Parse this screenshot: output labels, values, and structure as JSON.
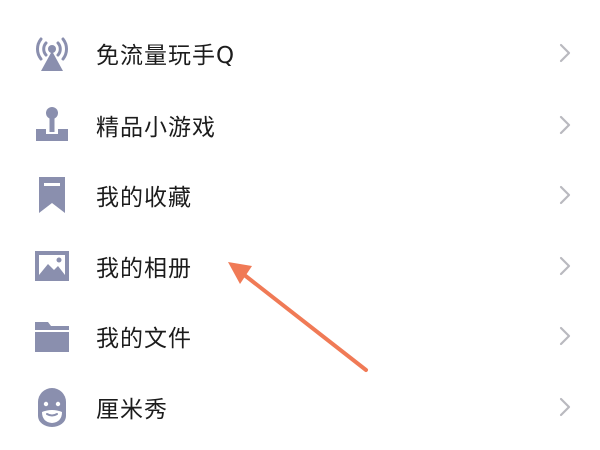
{
  "menu": {
    "items": [
      {
        "label": "免流量玩手Q",
        "icon": "antenna-icon"
      },
      {
        "label": "精品小游戏",
        "icon": "joystick-icon"
      },
      {
        "label": "我的收藏",
        "icon": "bookmark-icon"
      },
      {
        "label": "我的相册",
        "icon": "photo-album-icon"
      },
      {
        "label": "我的文件",
        "icon": "folder-icon"
      },
      {
        "label": "厘米秀",
        "icon": "cmshow-avatar-icon"
      }
    ]
  },
  "colors": {
    "icon": "#8a8fae",
    "text": "#1c1c1c",
    "chevron": "#b9b9bf",
    "annotation_arrow": "#f07a56"
  }
}
